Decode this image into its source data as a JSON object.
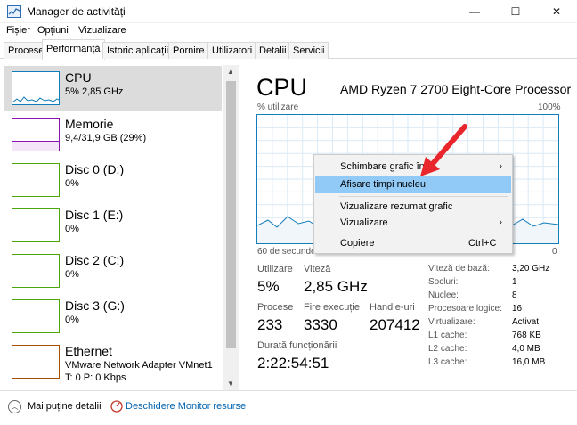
{
  "window": {
    "title": "Manager de activități",
    "minimize": "—",
    "maximize": "☐",
    "close": "✕"
  },
  "menu": {
    "items": [
      "Fișier",
      "Opțiuni",
      "Vizualizare"
    ]
  },
  "tabs": [
    "Procese",
    "Performanță",
    "Istoric aplicații",
    "Pornire",
    "Utilizatori",
    "Detalii",
    "Servicii"
  ],
  "active_tab": "Performanță",
  "sidebar": {
    "items": [
      {
        "title": "CPU",
        "sub": "5% 2,85 GHz",
        "sub2": "",
        "color": "#117dbb",
        "selected": true
      },
      {
        "title": "Memorie",
        "sub": "9,4/31,9 GB (29%)",
        "sub2": "",
        "color": "#8b12ae",
        "selected": false
      },
      {
        "title": "Disc 0 (D:)",
        "sub": "0%",
        "sub2": "",
        "color": "#4da60c",
        "selected": false
      },
      {
        "title": "Disc 1 (E:)",
        "sub": "0%",
        "sub2": "",
        "color": "#4da60c",
        "selected": false
      },
      {
        "title": "Disc 2 (C:)",
        "sub": "0%",
        "sub2": "",
        "color": "#4da60c",
        "selected": false
      },
      {
        "title": "Disc 3 (G:)",
        "sub": "0%",
        "sub2": "",
        "color": "#4da60c",
        "selected": false
      },
      {
        "title": "Ethernet",
        "sub": "VMware Network Adapter VMnet1",
        "sub2": "T: 0 P: 0 Kbps",
        "color": "#a74f01",
        "selected": false
      }
    ]
  },
  "main": {
    "title": "CPU",
    "model": "AMD Ryzen 7 2700 Eight-Core Processor",
    "util_label": "% utilizare",
    "util_max": "100%",
    "axis_left": "60 de secunde",
    "axis_right": "0",
    "graph_color": "#117dbb",
    "stats": {
      "utilizare_label": "Utilizare",
      "utilizare_value": "5%",
      "viteza_label": "Viteză",
      "viteza_value": "2,85 GHz",
      "procese_label": "Procese",
      "procese_value": "233",
      "fire_label": "Fire execuție",
      "fire_value": "3330",
      "handle_label": "Handle-uri",
      "handle_value": "207412",
      "durata_label": "Durată funcționării",
      "durata_value": "2:22:54:51"
    },
    "info": [
      {
        "label": "Viteză de bază:",
        "value": "3,20 GHz"
      },
      {
        "label": "Socluri:",
        "value": "1"
      },
      {
        "label": "Nuclee:",
        "value": "8"
      },
      {
        "label": "Procesoare logice:",
        "value": "16"
      },
      {
        "label": "Virtualizare:",
        "value": "Activat"
      },
      {
        "label": "L1 cache:",
        "value": "768 KB"
      },
      {
        "label": "L2 cache:",
        "value": "4,0 MB"
      },
      {
        "label": "L3 cache:",
        "value": "16,0 MB"
      }
    ]
  },
  "context_menu": {
    "items": [
      {
        "label": "Schimbare grafic în",
        "submenu": true,
        "shortcut": ""
      },
      {
        "label": "Afișare timpi nucleu",
        "submenu": false,
        "shortcut": "",
        "highlighted": true
      },
      {
        "label": "Vizualizare rezumat grafic",
        "submenu": false,
        "shortcut": ""
      },
      {
        "label": "Vizualizare",
        "submenu": true,
        "shortcut": ""
      },
      {
        "label": "Copiere",
        "submenu": false,
        "shortcut": "Ctrl+C"
      }
    ],
    "arrow_glyph": "›",
    "highlight_color": "#91c9f7",
    "pointer_arrow_color": "#e8262b"
  },
  "footer": {
    "fewer_details": "Mai puține detalii",
    "resource_monitor": "Deschidere Monitor resurse"
  }
}
